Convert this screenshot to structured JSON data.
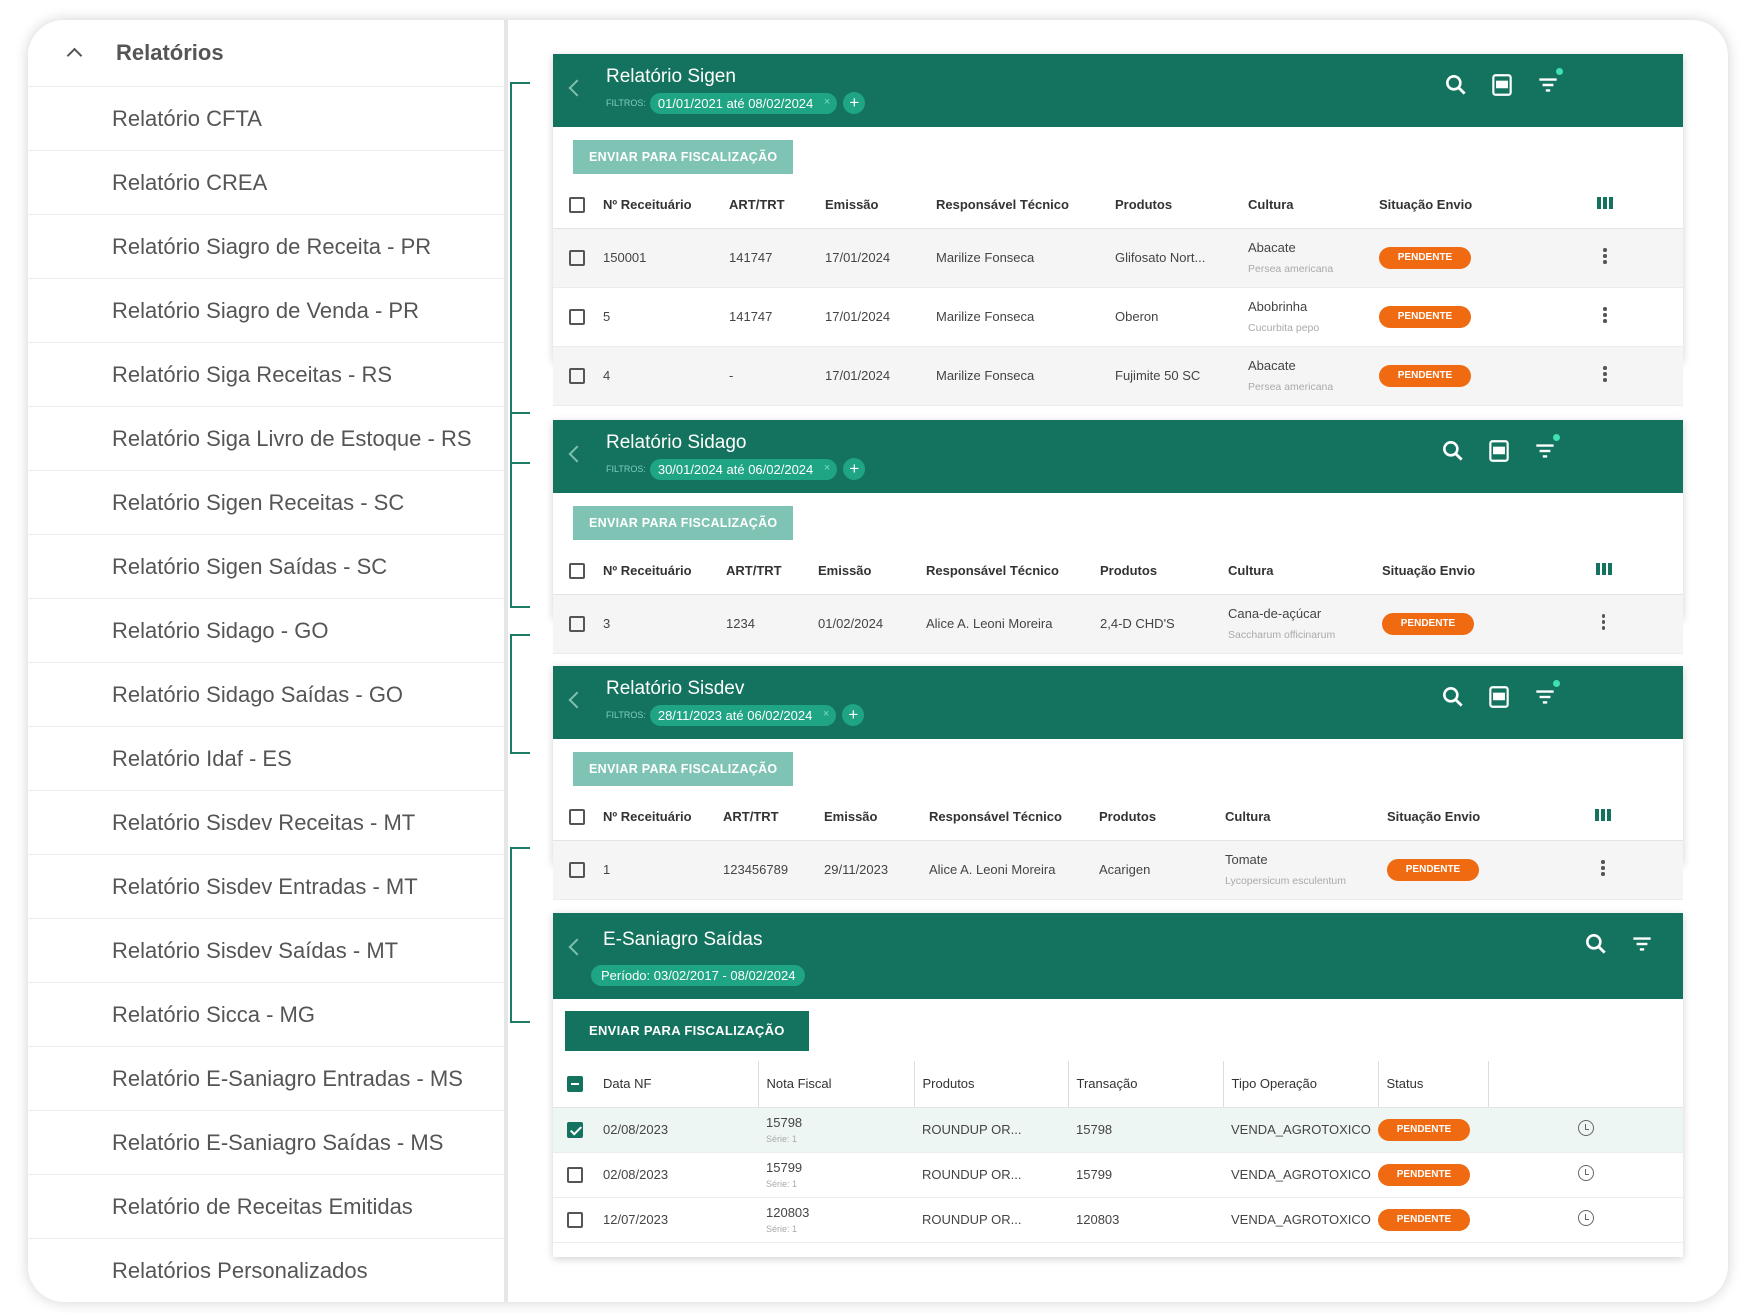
{
  "sidebar": {
    "title": "Relatórios",
    "items": [
      "Relatório CFTA",
      "Relatório CREA",
      "Relatório Siagro de Receita - PR",
      "Relatório Siagro de Venda - PR",
      "Relatório Siga Receitas - RS",
      "Relatório Siga Livro de Estoque - RS",
      "Relatório Sigen Receitas - SC",
      "Relatório Sigen Saídas - SC",
      "Relatório Sidago - GO",
      "Relatório Sidago Saídas - GO",
      "Relatório Idaf - ES",
      "Relatório Sisdev Receitas - MT",
      "Relatório Sisdev Entradas - MT",
      "Relatório Sisdev Saídas - MT",
      "Relatório Sicca - MG",
      "Relatório E-Saniagro Entradas - MS",
      "Relatório E-Saniagro Saídas - MS",
      "Relatório de Receitas Emitidas",
      "Relatórios Personalizados"
    ]
  },
  "common": {
    "filtros": "FILTROS:",
    "send": "ENVIAR PARA FISCALIZAÇÃO",
    "plus": "+",
    "x": "×",
    "pendente": "PENDENTE"
  },
  "sigen": {
    "title": "Relatório Sigen",
    "filter": "01/01/2021 até 08/02/2024",
    "headers": [
      "Nº Receituário",
      "ART/TRT",
      "Emissão",
      "Responsável Técnico",
      "Produtos",
      "Cultura",
      "Situação Envio"
    ],
    "rows": [
      {
        "rec": "150001",
        "art": "141747",
        "em": "17/01/2024",
        "resp": "Marilize Fonseca",
        "prod": "Glifosato Nort...",
        "cult": "Abacate",
        "sci": "Persea americana"
      },
      {
        "rec": "5",
        "art": "141747",
        "em": "17/01/2024",
        "resp": "Marilize Fonseca",
        "prod": "Oberon",
        "cult": "Abobrinha",
        "sci": "Cucurbita pepo"
      },
      {
        "rec": "4",
        "art": "-",
        "em": "17/01/2024",
        "resp": "Marilize Fonseca",
        "prod": "Fujimite 50 SC",
        "cult": "Abacate",
        "sci": "Persea americana"
      }
    ]
  },
  "sidago": {
    "title": "Relatório Sidago",
    "filter": "30/01/2024 até 06/02/2024",
    "headers": [
      "Nº Receituário",
      "ART/TRT",
      "Emissão",
      "Responsável Técnico",
      "Produtos",
      "Cultura",
      "Situação Envio"
    ],
    "rows": [
      {
        "rec": "3",
        "art": "1234",
        "em": "01/02/2024",
        "resp": "Alice A. Leoni Moreira",
        "prod": "2,4-D CHD'S",
        "cult": "Cana-de-açúcar",
        "sci": "Saccharum officinarum"
      }
    ]
  },
  "sisdev": {
    "title": "Relatório Sisdev",
    "filter": "28/11/2023 até 06/02/2024",
    "headers": [
      "Nº Receituário",
      "ART/TRT",
      "Emissão",
      "Responsável Técnico",
      "Produtos",
      "Cultura",
      "Situação Envio"
    ],
    "rows": [
      {
        "rec": "1",
        "art": "123456789",
        "em": "29/11/2023",
        "resp": "Alice A. Leoni Moreira",
        "prod": "Acarigen",
        "cult": "Tomate",
        "sci": "Lycopersicum esculentum"
      }
    ]
  },
  "saniagro": {
    "title": "E-Saniagro Saídas",
    "periodo": "Período: 03/02/2017 - 08/02/2024",
    "headers": [
      "Data NF",
      "Nota Fiscal",
      "Produtos",
      "Transação",
      "Tipo Operação",
      "Status"
    ],
    "rows": [
      {
        "data": "02/08/2023",
        "nf": "15798",
        "serie": "Série: 1",
        "prod": "ROUNDUP OR...",
        "trans": "15798",
        "tipo": "VENDA_AGROTOXICO"
      },
      {
        "data": "02/08/2023",
        "nf": "15799",
        "serie": "Série: 1",
        "prod": "ROUNDUP OR...",
        "trans": "15799",
        "tipo": "VENDA_AGROTOXICO"
      },
      {
        "data": "12/07/2023",
        "nf": "120803",
        "serie": "Série: 1",
        "prod": "ROUNDUP OR...",
        "trans": "120803",
        "tipo": "VENDA_AGROTOXICO"
      }
    ]
  },
  "colors": {
    "primary": "#14735f",
    "accent": "#1fa484",
    "badge": "#f06a12"
  },
  "icons": [
    "chevron-up-icon",
    "chevron-left-icon",
    "search-icon",
    "csv-icon",
    "filter-icon",
    "columns-icon",
    "more-vert-icon",
    "history-icon"
  ]
}
